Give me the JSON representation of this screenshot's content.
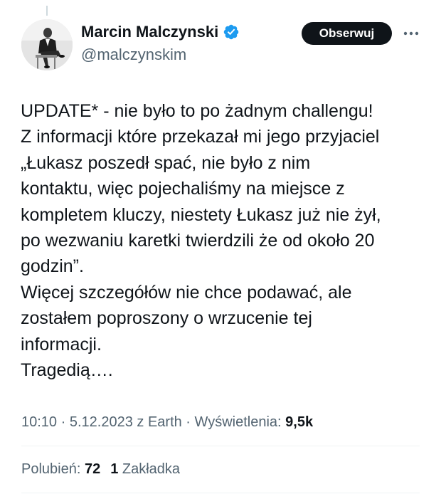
{
  "author": {
    "display_name": "Marcin Malczynski",
    "handle": "@malczynskim",
    "verified": true,
    "verified_color": "#1d9bf0"
  },
  "follow_button": {
    "label": "Obserwuj",
    "bg_color": "#0f1419"
  },
  "more_menu": {
    "icon": "more-horizontal-icon"
  },
  "tweet": {
    "lines": [
      "UPDATE* - nie było to po żadnym challengu!",
      "Z informacji które przekazał mi jego przyjaciel",
      "„Łukasz poszedł spać, nie było z nim",
      "kontaktu, więc pojechaliśmy na miejsce z",
      "kompletem kluczy, niestety Łukasz już nie żył,",
      "po wezwaniu karetki twierdzili że od około 20",
      "godzin”.",
      "Więcej szczegółów nie chce podawać, ale",
      "zostałem poproszony o wrzucenie tej",
      "informacji.",
      "Tragedią…."
    ]
  },
  "meta": {
    "time": "10:10",
    "separator": " · ",
    "date": "5.12.2023",
    "source": " z Earth",
    "views_label": "Wyświetlenia: ",
    "views_count": "9,5k"
  },
  "stats": {
    "likes_label": "Polubień: ",
    "likes_count": "72",
    "bookmarks_count": "1",
    "bookmarks_label": " Zakładka"
  },
  "colors": {
    "text_primary": "#0f1419",
    "text_secondary": "#536471",
    "divider": "#eff3f4"
  }
}
